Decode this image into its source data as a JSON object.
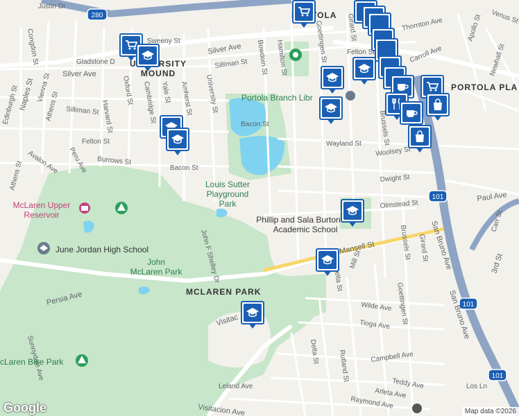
{
  "streets": {
    "justin": "Justin Dr",
    "sweeny": "Sweeny St",
    "gladstone": "Gladstone D",
    "silver_w": "Silver Ave",
    "silver_e": "Silver Ave",
    "silliman_e": "Silliman St",
    "silliman_w": "Silliman St",
    "felton_w": "Felton St",
    "felton_e": "Felton St",
    "burrows": "Burrows St",
    "bacon_w": "Bacon St",
    "bacon_e": "Bacon St",
    "wayland": "Wayland St",
    "woolsey": "Woolsey St",
    "dwight": "Dwight St",
    "olmstead": "Olmstead St",
    "mansell": "Mansell St",
    "wilde": "Wilde Ave",
    "tioga": "Tioga Ave",
    "campbell": "Campbell Ave",
    "teddy": "Teddy Ave",
    "arleta": "Arleta Ave",
    "raymond": "Raymond Ave",
    "leland": "Leland Ave",
    "visitacion": "Visitacion Ave",
    "visitacion_w": "Visitac",
    "persia": "Persia Ave",
    "paul": "Paul Ave",
    "thornton": "Thornton Ave",
    "carroll": "Carroll Ave",
    "los": "Los Ln",
    "naples": "Naples St",
    "edinburgh": "Edinburgh St",
    "vienna": "Vienna St",
    "athens_n": "Athens St",
    "athens_s": "Athens St",
    "avalon": "Avalon Ave",
    "peru": "Peru Ave",
    "harvard": "Harvard St",
    "oxford": "Oxford St",
    "cambridge": "Cambridge St",
    "yale": "Yale St",
    "amherst": "Amherst St",
    "university": "University St",
    "bowdoin": "Bowdoin St",
    "hamilton": "Hamilton St",
    "goettingen_n": "Goettingen St",
    "goettingen_s": "Goettingen St",
    "girard_n": "Girard St",
    "girard_s": "Girard St",
    "brussels_n": "Brussels St",
    "brussels_s": "Brussels St",
    "delta_n": "Delta St",
    "delta_s": "Delta St",
    "mill": "Mill St",
    "rutland": "Rutland St",
    "john_f_shelley": "John F Shelley Dr",
    "sunnydale": "Sunnydale Ave",
    "congdon": "Congdon St",
    "san_bruno_1": "San Bruno Ave",
    "san_bruno_2": "San Bruno Ave",
    "third": "3rd St",
    "carr": "Carr St",
    "newhall": "Newhall St",
    "apollo": "Apollo St",
    "venus": "Venus St",
    "hwy101_a": "101",
    "hwy101_b": "101",
    "hwy101_c": "101",
    "hwy280": "280"
  },
  "places": {
    "university_mound": "UNIVERSITY\nMOUND",
    "portola": "PORTOLA",
    "portola_place": "PORTOLA PLA",
    "portola_library": "Portola Branch Libr",
    "louis_sutter_1": "Louis Sutter",
    "louis_sutter_2": "Playground",
    "louis_sutter_3": "Park",
    "mclaren_reservoir_1": "McLaren Upper",
    "mclaren_reservoir_2": "Reservoir",
    "june_jordan": "June Jordan High School",
    "john_mclaren_1": "John",
    "john_mclaren_2": "McLaren Park",
    "mclaren_park": "MCLAREN PARK",
    "burton_1": "Phillip and Sala Burton",
    "burton_2": "Academic School",
    "bike_park": "cLaren Bike Park"
  },
  "markers": [
    {
      "icon": "cart-icon"
    },
    {
      "icon": "school-icon"
    },
    {
      "icon": "school-icon"
    },
    {
      "icon": "school-icon"
    },
    {
      "icon": "school-icon"
    },
    {
      "icon": "school-icon"
    },
    {
      "icon": "school-icon"
    },
    {
      "icon": "school-icon"
    },
    {
      "icon": "school-icon"
    },
    {
      "icon": "cart-icon"
    },
    {
      "icon": "cafe-icon"
    },
    {
      "icon": "restaurant-icon"
    },
    {
      "icon": "cafe-icon"
    },
    {
      "icon": "bag-icon"
    },
    {
      "icon": "bag-icon"
    },
    {
      "icon": "cart-icon"
    },
    {
      "icon": "school-icon"
    }
  ],
  "footer": {
    "logo": "Google",
    "attribution": "Map data ©2026"
  },
  "colors": {
    "park": "#c8e6c9",
    "water": "#7fd3f0",
    "freeway": "#8ea4c4",
    "marker": "#1a5fb4"
  }
}
